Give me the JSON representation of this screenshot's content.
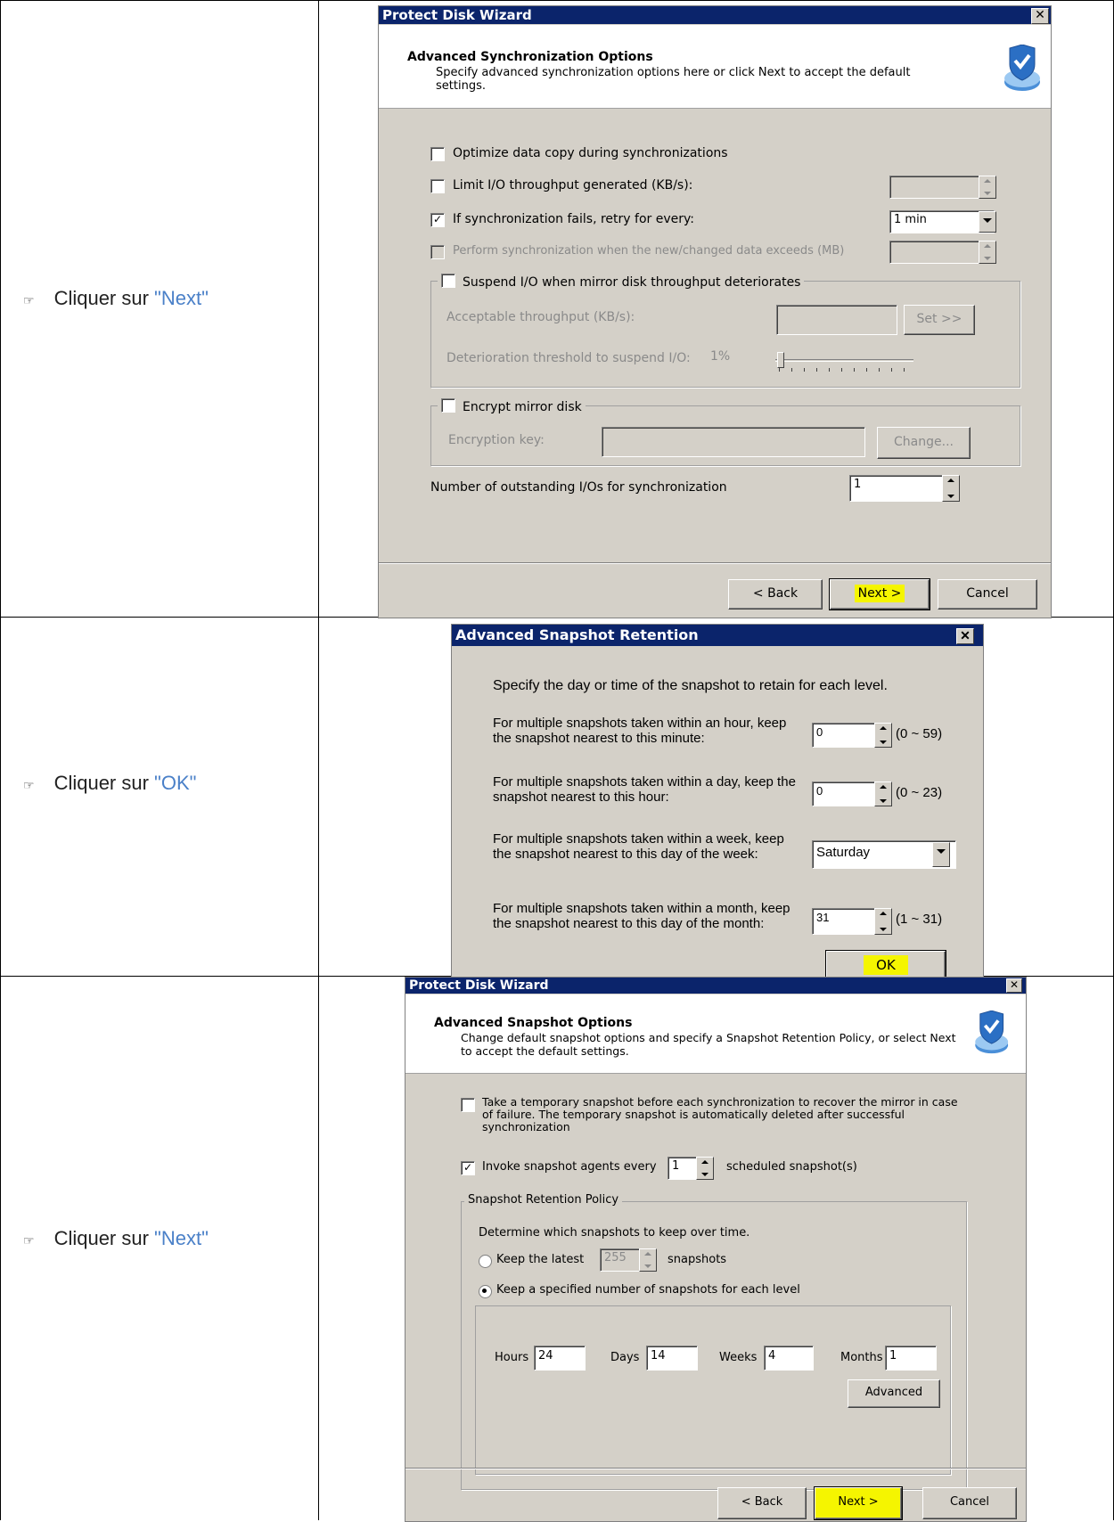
{
  "instructions": [
    {
      "prefix": "Cliquer sur ",
      "quoted": "\"Next\""
    },
    {
      "prefix": "Cliquer sur ",
      "quoted": "\"OK\""
    },
    {
      "prefix": "Cliquer sur ",
      "quoted": "\"Next\""
    }
  ],
  "icons": {
    "hand": "pointing-hand-icon",
    "close": "close-icon",
    "wizard": "shield-disk-icon"
  },
  "dialog1": {
    "title": "Protect Disk Wizard",
    "close": "✕",
    "header_title": "Advanced Synchronization Options",
    "header_sub": "Specify advanced synchronization options here or click Next to accept the default settings.",
    "opt_optimize": "Optimize data copy during synchronizations",
    "opt_limit": "Limit I/O throughput generated (KB/s):",
    "opt_retry": "If synchronization fails, retry for every:",
    "retry_value": "1 min",
    "opt_perform": "Perform synchronization when the new/changed data exceeds (MB)",
    "opt_suspend": "Suspend I/O when mirror disk throughput deteriorates",
    "acceptable": "Acceptable throughput (KB/s):",
    "set_btn": "Set >>",
    "deterioration": "Deterioration threshold to suspend I/O:",
    "deterioration_value": "1%",
    "opt_encrypt": "Encrypt mirror disk",
    "encryption_key": "Encryption key:",
    "change_btn": "Change...",
    "outstanding": "Number of outstanding I/Os for synchronization",
    "outstanding_value": "1",
    "back": "< Back",
    "next": "Next >",
    "cancel": "Cancel",
    "checkmark": "✓"
  },
  "dialog2": {
    "title": "Advanced Snapshot Retention",
    "close": "✕",
    "intro": "Specify the day or time of the snapshot to retain for each level.",
    "hour_label": "For multiple snapshots taken within an hour, keep the snapshot nearest to this minute:",
    "hour_value": "0",
    "hour_range": "(0 ~ 59)",
    "day_label": "For multiple snapshots taken within a day, keep the snapshot nearest to this hour:",
    "day_value": "0",
    "day_range": "(0 ~ 23)",
    "week_label": "For multiple snapshots taken within a week, keep the snapshot nearest to this day of the week:",
    "week_value": "Saturday",
    "month_label": "For multiple snapshots taken within a month, keep the snapshot nearest to this day of the month:",
    "month_value": "31",
    "month_range": "(1 ~ 31)",
    "ok": "OK"
  },
  "dialog3": {
    "title": "Protect Disk Wizard",
    "close": "✕",
    "header_title": "Advanced Snapshot Options",
    "header_sub": "Change default snapshot options and specify a Snapshot Retention Policy, or select Next to accept the default settings.",
    "opt_temp": "Take a temporary snapshot before each synchronization to recover the mirror in case of failure. The temporary snapshot is automatically deleted after successful synchronization",
    "opt_invoke": "Invoke snapshot agents every",
    "invoke_value": "1",
    "invoke_suffix": "scheduled snapshot(s)",
    "group_title": "Snapshot Retention Policy",
    "determine": "Determine which snapshots to keep over time.",
    "keep_latest": "Keep the latest",
    "keep_latest_value": "255",
    "keep_latest_suffix": "snapshots",
    "keep_specified": "Keep a specified number of snapshots for each level",
    "hours_label": "Hours",
    "hours_value": "24",
    "days_label": "Days",
    "days_value": "14",
    "weeks_label": "Weeks",
    "weeks_value": "4",
    "months_label": "Months",
    "months_value": "1",
    "advanced": "Advanced",
    "back": "< Back",
    "next": "Next >",
    "cancel": "Cancel",
    "checkmark": "✓"
  }
}
